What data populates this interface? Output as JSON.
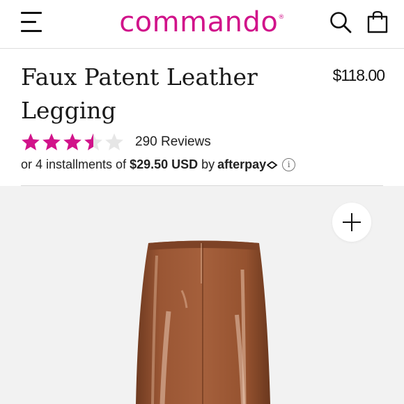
{
  "header": {
    "logo_text": "commando",
    "logo_mark": "®",
    "brand_color": "#d1138a",
    "icons": [
      "hamburger-menu-icon",
      "search-icon",
      "shopping-bag-icon"
    ]
  },
  "product": {
    "title": "Faux Patent Leather Legging",
    "price": "$118.00",
    "rating": {
      "value": 3.5,
      "max": 5,
      "star_color": "#d1138a",
      "empty_star_color": "#e6e6e6",
      "reviews_label": "290 Reviews"
    },
    "installments": {
      "prefix": "or 4 installments of",
      "amount": "$29.50 USD",
      "by": "by",
      "provider": "afterpay",
      "info_icon": "i"
    }
  },
  "gallery": {
    "background": "#f2f2f2",
    "image_subject": "brown faux patent leather legging",
    "zoom_icon": "plus-icon"
  }
}
